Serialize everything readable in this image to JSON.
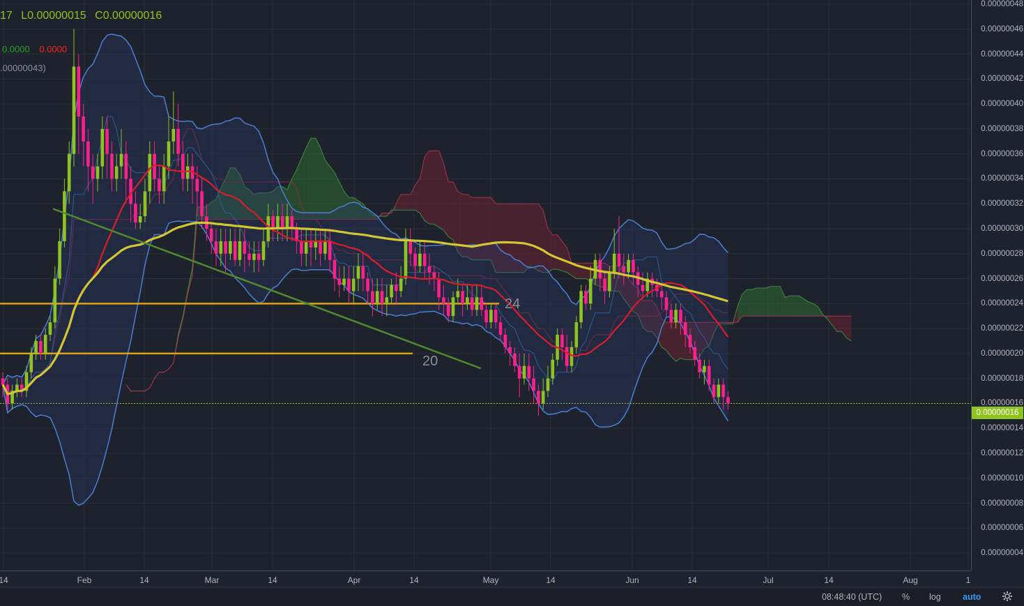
{
  "legend": {
    "ohlc_tail": "17",
    "low": "L0.00000015",
    "close": "C0.00000016",
    "ind1_a": "0.0000",
    "ind1_b": "0.0000",
    "ind2": ".00000043)"
  },
  "price_label": "0.00000016",
  "drawing_labels": {
    "level_upper": "24",
    "level_lower": "20"
  },
  "status_bar": {
    "time": "08:48:40 (UTC)",
    "percent": "%",
    "log": "log",
    "auto": "auto",
    "settings_icon": "gear-icon"
  },
  "colors": {
    "background": "#1e222d",
    "grid": "#2a2e39",
    "up": "#8fc31f",
    "down": "#ff1f8a",
    "bollinger": "#4a7fd4",
    "ema_red": "#d91e2a",
    "sma_yellow": "#d3c635",
    "trendline": "#4f8a2e",
    "hline": "#d9a418",
    "cloud_green": "#2f6b2f",
    "cloud_red": "#6b2230",
    "price_line": "#8fc31f"
  },
  "chart_data": {
    "type": "candlestick",
    "y_axis": {
      "min": 3e-08,
      "max": 4.8e-07,
      "ticks": [
        "0.00000048",
        "0.00000046",
        "0.00000044",
        "0.00000042",
        "0.00000040",
        "0.00000038",
        "0.00000036",
        "0.00000034",
        "0.00000032",
        "0.00000030",
        "0.00000028",
        "0.00000026",
        "0.00000024",
        "0.00000022",
        "0.00000020",
        "0.00000018",
        "0.00000016",
        "0.00000014",
        "0.00000012",
        "0.00000010",
        "0.00000008",
        "0.00000006",
        "0.00000004"
      ]
    },
    "x_axis": {
      "ticks": [
        "14",
        "Feb",
        "14",
        "Mar",
        "14",
        "Apr",
        "14",
        "May",
        "14",
        "Jun",
        "14",
        "Jul",
        "14",
        "Aug",
        "1"
      ]
    },
    "last_price": 1.6e-07,
    "horizontal_levels": [
      2.4e-07,
      2e-07
    ],
    "trendline": {
      "from": 3.16e-07,
      "to": 1.88e-07
    },
    "candles": [
      [
        1.8e-07,
        1.75e-07,
        1.85e-07,
        1.65e-07
      ],
      [
        1.75e-07,
        1.6e-07,
        1.8e-07,
        1.55e-07
      ],
      [
        1.6e-07,
        1.7e-07,
        1.75e-07,
        1.55e-07
      ],
      [
        1.7e-07,
        1.75e-07,
        1.8e-07,
        1.65e-07
      ],
      [
        1.75e-07,
        1.7e-07,
        1.8e-07,
        1.65e-07
      ],
      [
        1.7e-07,
        1.85e-07,
        1.9e-07,
        1.65e-07
      ],
      [
        1.85e-07,
        2e-07,
        2.05e-07,
        1.8e-07
      ],
      [
        2e-07,
        2.1e-07,
        2.15e-07,
        1.95e-07
      ],
      [
        2.1e-07,
        2e-07,
        2.15e-07,
        1.95e-07
      ],
      [
        2e-07,
        2.15e-07,
        2.2e-07,
        1.95e-07
      ],
      [
        2.15e-07,
        2.25e-07,
        2.3e-07,
        2.1e-07
      ],
      [
        2.25e-07,
        2.6e-07,
        2.7e-07,
        2.2e-07
      ],
      [
        2.6e-07,
        2.9e-07,
        3e-07,
        2.55e-07
      ],
      [
        2.9e-07,
        3.3e-07,
        3.4e-07,
        2.85e-07
      ],
      [
        3.3e-07,
        3.6e-07,
        3.7e-07,
        3.2e-07
      ],
      [
        3.6e-07,
        4.3e-07,
        4.6e-07,
        3.5e-07
      ],
      [
        4.3e-07,
        3.9e-07,
        4.4e-07,
        3.6e-07
      ],
      [
        3.9e-07,
        3.7e-07,
        4e-07,
        3.5e-07
      ],
      [
        3.7e-07,
        3.5e-07,
        3.8e-07,
        3.3e-07
      ],
      [
        3.5e-07,
        3.4e-07,
        3.6e-07,
        3.2e-07
      ],
      [
        3.4e-07,
        3.5e-07,
        3.6e-07,
        3.3e-07
      ],
      [
        3.5e-07,
        3.8e-07,
        3.9e-07,
        3.4e-07
      ],
      [
        3.8e-07,
        3.6e-07,
        3.9e-07,
        3.4e-07
      ],
      [
        3.6e-07,
        3.4e-07,
        3.7e-07,
        3.3e-07
      ],
      [
        3.4e-07,
        3.5e-07,
        3.6e-07,
        3.3e-07
      ],
      [
        3.5e-07,
        3.6e-07,
        3.8e-07,
        3.4e-07
      ],
      [
        3.6e-07,
        3.4e-07,
        3.7e-07,
        3.2e-07
      ],
      [
        3.4e-07,
        3.2e-07,
        3.5e-07,
        3.05e-07
      ],
      [
        3.2e-07,
        3.05e-07,
        3.3e-07,
        3e-07
      ],
      [
        3.05e-07,
        3.1e-07,
        3.2e-07,
        3e-07
      ],
      [
        3.1e-07,
        3.3e-07,
        3.4e-07,
        3.05e-07
      ],
      [
        3.3e-07,
        3.6e-07,
        3.7e-07,
        3.2e-07
      ],
      [
        3.6e-07,
        3.4e-07,
        3.7e-07,
        3.3e-07
      ],
      [
        3.4e-07,
        3.3e-07,
        3.5e-07,
        3.2e-07
      ],
      [
        3.3e-07,
        3.5e-07,
        3.6e-07,
        3.2e-07
      ],
      [
        3.5e-07,
        3.7e-07,
        3.9e-07,
        3.4e-07
      ],
      [
        3.7e-07,
        3.8e-07,
        4.1e-07,
        3.6e-07
      ],
      [
        3.8e-07,
        3.6e-07,
        4e-07,
        3.5e-07
      ],
      [
        3.6e-07,
        3.4e-07,
        3.7e-07,
        3.3e-07
      ],
      [
        3.4e-07,
        3.5e-07,
        3.6e-07,
        3.3e-07
      ],
      [
        3.5e-07,
        3.4e-07,
        3.6e-07,
        3.2e-07
      ],
      [
        3.4e-07,
        3.3e-07,
        3.5e-07,
        3.1e-07
      ],
      [
        3.3e-07,
        3.1e-07,
        3.4e-07,
        3e-07
      ],
      [
        3.1e-07,
        3e-07,
        3.2e-07,
        2.9e-07
      ],
      [
        3e-07,
        2.9e-07,
        3.05e-07,
        2.8e-07
      ],
      [
        2.9e-07,
        2.8e-07,
        3e-07,
        2.7e-07
      ],
      [
        2.8e-07,
        2.9e-07,
        3e-07,
        2.7e-07
      ],
      [
        2.9e-07,
        2.8e-07,
        3e-07,
        2.65e-07
      ],
      [
        2.8e-07,
        2.9e-07,
        3e-07,
        2.75e-07
      ],
      [
        2.9e-07,
        2.75e-07,
        3e-07,
        2.7e-07
      ],
      [
        2.75e-07,
        2.9e-07,
        3e-07,
        2.7e-07
      ],
      [
        2.9e-07,
        2.8e-07,
        3e-07,
        2.65e-07
      ],
      [
        2.8e-07,
        2.75e-07,
        2.9e-07,
        2.7e-07
      ],
      [
        2.75e-07,
        2.8e-07,
        2.9e-07,
        2.65e-07
      ],
      [
        2.8e-07,
        2.75e-07,
        2.9e-07,
        2.65e-07
      ],
      [
        2.75e-07,
        2.9e-07,
        3e-07,
        2.7e-07
      ],
      [
        2.9e-07,
        3.1e-07,
        3.2e-07,
        2.85e-07
      ],
      [
        3.1e-07,
        3e-07,
        3.15e-07,
        2.9e-07
      ],
      [
        3e-07,
        3.1e-07,
        3.2e-07,
        2.9e-07
      ],
      [
        3.1e-07,
        3e-07,
        3.2e-07,
        2.9e-07
      ],
      [
        3e-07,
        3.1e-07,
        3.2e-07,
        2.9e-07
      ],
      [
        3.1e-07,
        3e-07,
        3.15e-07,
        2.9e-07
      ],
      [
        3e-07,
        2.9e-07,
        3.05e-07,
        2.8e-07
      ],
      [
        2.9e-07,
        2.8e-07,
        3e-07,
        2.7e-07
      ],
      [
        2.8e-07,
        2.9e-07,
        3e-07,
        2.7e-07
      ],
      [
        2.9e-07,
        2.85e-07,
        3e-07,
        2.7e-07
      ],
      [
        2.85e-07,
        2.9e-07,
        3e-07,
        2.75e-07
      ],
      [
        2.9e-07,
        2.8e-07,
        3e-07,
        2.7e-07
      ],
      [
        2.8e-07,
        2.9e-07,
        3e-07,
        2.75e-07
      ],
      [
        2.9e-07,
        2.75e-07,
        3e-07,
        2.65e-07
      ],
      [
        2.75e-07,
        2.6e-07,
        2.8e-07,
        2.5e-07
      ],
      [
        2.6e-07,
        2.55e-07,
        2.7e-07,
        2.45e-07
      ],
      [
        2.55e-07,
        2.6e-07,
        2.7e-07,
        2.5e-07
      ],
      [
        2.6e-07,
        2.5e-07,
        2.7e-07,
        2.4e-07
      ],
      [
        2.5e-07,
        2.6e-07,
        2.7e-07,
        2.4e-07
      ],
      [
        2.6e-07,
        2.7e-07,
        2.8e-07,
        2.5e-07
      ],
      [
        2.7e-07,
        2.6e-07,
        2.8e-07,
        2.5e-07
      ],
      [
        2.6e-07,
        2.5e-07,
        2.65e-07,
        2.4e-07
      ],
      [
        2.5e-07,
        2.4e-07,
        2.6e-07,
        2.3e-07
      ],
      [
        2.4e-07,
        2.5e-07,
        2.6e-07,
        2.35e-07
      ],
      [
        2.5e-07,
        2.4e-07,
        2.6e-07,
        2.3e-07
      ],
      [
        2.4e-07,
        2.45e-07,
        2.55e-07,
        2.3e-07
      ],
      [
        2.45e-07,
        2.55e-07,
        2.6e-07,
        2.4e-07
      ],
      [
        2.55e-07,
        2.5e-07,
        2.65e-07,
        2.4e-07
      ],
      [
        2.5e-07,
        2.6e-07,
        2.7e-07,
        2.45e-07
      ],
      [
        2.6e-07,
        2.9e-07,
        3e-07,
        2.55e-07
      ],
      [
        2.9e-07,
        2.8e-07,
        3e-07,
        2.7e-07
      ],
      [
        2.8e-07,
        2.7e-07,
        2.85e-07,
        2.6e-07
      ],
      [
        2.7e-07,
        2.8e-07,
        2.9e-07,
        2.65e-07
      ],
      [
        2.8e-07,
        2.7e-07,
        2.9e-07,
        2.6e-07
      ],
      [
        2.7e-07,
        2.65e-07,
        2.8e-07,
        2.55e-07
      ],
      [
        2.65e-07,
        2.6e-07,
        2.7e-07,
        2.5e-07
      ],
      [
        2.6e-07,
        2.45e-07,
        2.65e-07,
        2.35e-07
      ],
      [
        2.45e-07,
        2.4e-07,
        2.55e-07,
        2.3e-07
      ],
      [
        2.4e-07,
        2.3e-07,
        2.45e-07,
        2.25e-07
      ],
      [
        2.3e-07,
        2.45e-07,
        2.5e-07,
        2.25e-07
      ],
      [
        2.45e-07,
        2.5e-07,
        2.6e-07,
        2.4e-07
      ],
      [
        2.5e-07,
        2.4e-07,
        2.55e-07,
        2.3e-07
      ],
      [
        2.4e-07,
        2.45e-07,
        2.55e-07,
        2.35e-07
      ],
      [
        2.45e-07,
        2.35e-07,
        2.55e-07,
        2.3e-07
      ],
      [
        2.35e-07,
        2.45e-07,
        2.55e-07,
        2.3e-07
      ],
      [
        2.45e-07,
        2.35e-07,
        2.55e-07,
        2.3e-07
      ],
      [
        2.35e-07,
        2.25e-07,
        2.4e-07,
        2.2e-07
      ],
      [
        2.25e-07,
        2.35e-07,
        2.4e-07,
        2.2e-07
      ],
      [
        2.35e-07,
        2.25e-07,
        2.4e-07,
        2.2e-07
      ],
      [
        2.25e-07,
        2.15e-07,
        2.3e-07,
        2.1e-07
      ],
      [
        2.15e-07,
        2.05e-07,
        2.2e-07,
        2e-07
      ],
      [
        2.05e-07,
        2e-07,
        2.1e-07,
        1.9e-07
      ],
      [
        2e-07,
        1.9e-07,
        2.05e-07,
        1.85e-07
      ],
      [
        1.9e-07,
        1.8e-07,
        2e-07,
        1.65e-07
      ],
      [
        1.8e-07,
        1.9e-07,
        2e-07,
        1.75e-07
      ],
      [
        1.9e-07,
        1.8e-07,
        2e-07,
        1.7e-07
      ],
      [
        1.8e-07,
        1.7e-07,
        1.9e-07,
        1.6e-07
      ],
      [
        1.7e-07,
        1.6e-07,
        1.75e-07,
        1.5e-07
      ],
      [
        1.6e-07,
        1.7e-07,
        1.8e-07,
        1.55e-07
      ],
      [
        1.7e-07,
        1.8e-07,
        1.9e-07,
        1.65e-07
      ],
      [
        1.8e-07,
        1.95e-07,
        2e-07,
        1.75e-07
      ],
      [
        1.95e-07,
        2.15e-07,
        2.2e-07,
        1.9e-07
      ],
      [
        2.15e-07,
        2.05e-07,
        2.2e-07,
        1.95e-07
      ],
      [
        2.05e-07,
        1.9e-07,
        2.15e-07,
        1.85e-07
      ],
      [
        1.9e-07,
        2.05e-07,
        2.1e-07,
        1.85e-07
      ],
      [
        2.05e-07,
        2.25e-07,
        2.3e-07,
        2e-07
      ],
      [
        2.25e-07,
        2.5e-07,
        2.55e-07,
        2.2e-07
      ],
      [
        2.5e-07,
        2.4e-07,
        2.55e-07,
        2.35e-07
      ],
      [
        2.4e-07,
        2.6e-07,
        2.7e-07,
        2.35e-07
      ],
      [
        2.6e-07,
        2.75e-07,
        2.8e-07,
        2.55e-07
      ],
      [
        2.75e-07,
        2.6e-07,
        2.8e-07,
        2.5e-07
      ],
      [
        2.6e-07,
        2.5e-07,
        2.65e-07,
        2.4e-07
      ],
      [
        2.5e-07,
        2.65e-07,
        2.7e-07,
        2.45e-07
      ],
      [
        2.65e-07,
        2.8e-07,
        3e-07,
        2.6e-07
      ],
      [
        2.8e-07,
        2.7e-07,
        3.1e-07,
        2.6e-07
      ],
      [
        2.7e-07,
        2.65e-07,
        2.8e-07,
        2.55e-07
      ],
      [
        2.65e-07,
        2.75e-07,
        2.8e-07,
        2.6e-07
      ],
      [
        2.75e-07,
        2.65e-07,
        2.8e-07,
        2.55e-07
      ],
      [
        2.65e-07,
        2.55e-07,
        2.7e-07,
        2.45e-07
      ],
      [
        2.55e-07,
        2.5e-07,
        2.65e-07,
        2.45e-07
      ],
      [
        2.5e-07,
        2.6e-07,
        2.65e-07,
        2.45e-07
      ],
      [
        2.6e-07,
        2.55e-07,
        2.65e-07,
        2.45e-07
      ],
      [
        2.55e-07,
        2.5e-07,
        2.6e-07,
        2.45e-07
      ],
      [
        2.5e-07,
        2.45e-07,
        2.55e-07,
        2.35e-07
      ],
      [
        2.45e-07,
        2.35e-07,
        2.5e-07,
        2.3e-07
      ],
      [
        2.35e-07,
        2.25e-07,
        2.4e-07,
        2.2e-07
      ],
      [
        2.25e-07,
        2.35e-07,
        2.4e-07,
        2.2e-07
      ],
      [
        2.35e-07,
        2.25e-07,
        2.4e-07,
        2.15e-07
      ],
      [
        2.25e-07,
        2.15e-07,
        2.3e-07,
        2.05e-07
      ],
      [
        2.15e-07,
        2.05e-07,
        2.2e-07,
        2e-07
      ],
      [
        2.05e-07,
        1.95e-07,
        2.1e-07,
        1.9e-07
      ],
      [
        1.95e-07,
        1.85e-07,
        2e-07,
        1.8e-07
      ],
      [
        1.85e-07,
        1.9e-07,
        1.95e-07,
        1.75e-07
      ],
      [
        1.9e-07,
        1.75e-07,
        1.95e-07,
        1.7e-07
      ],
      [
        1.75e-07,
        1.65e-07,
        1.8e-07,
        1.6e-07
      ],
      [
        1.65e-07,
        1.75e-07,
        1.8e-07,
        1.6e-07
      ],
      [
        1.75e-07,
        1.65e-07,
        1.8e-07,
        1.55e-07
      ],
      [
        1.65e-07,
        1.6e-07,
        1.7e-07,
        1.55e-07
      ]
    ]
  }
}
